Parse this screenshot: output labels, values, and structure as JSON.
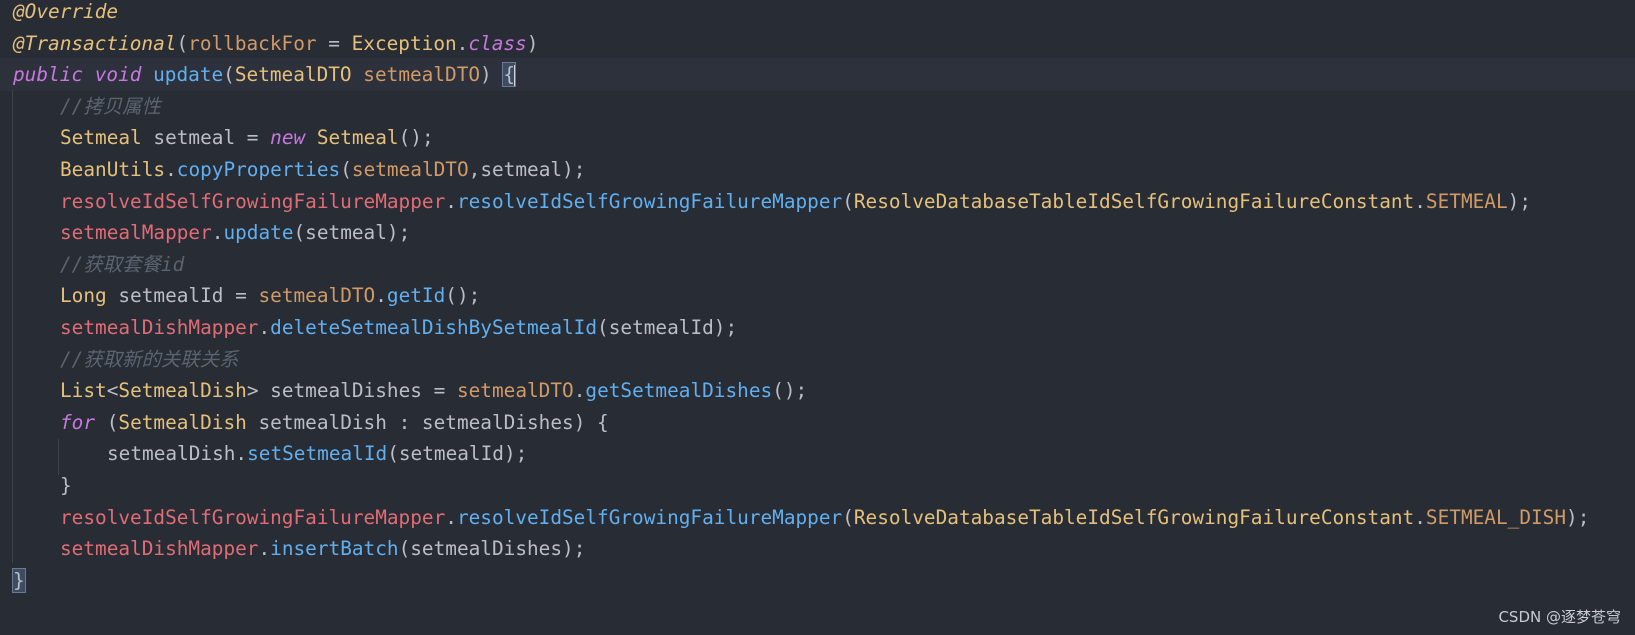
{
  "colors": {
    "background": "#282c34",
    "current_line": "#2c313c",
    "default": "#bbbec4",
    "annotation": "#e5c07b",
    "keyword": "#c678dd",
    "function": "#61afef",
    "type": "#e5c07b",
    "field": "#e06c75",
    "param": "#d19a66",
    "comment": "#5c6370",
    "constant": "#d19a66"
  },
  "code_lines": [
    {
      "indent": 0,
      "tokens": [
        {
          "t": "@Override",
          "c": "annotation",
          "i": true
        }
      ]
    },
    {
      "indent": 0,
      "tokens": [
        {
          "t": "@Transactional",
          "c": "annotation",
          "i": true
        },
        {
          "t": "(",
          "c": "default"
        },
        {
          "t": "rollbackFor",
          "c": "param"
        },
        {
          "t": " = ",
          "c": "default"
        },
        {
          "t": "Exception",
          "c": "type"
        },
        {
          "t": ".",
          "c": "default"
        },
        {
          "t": "class",
          "c": "keyword",
          "i": true
        },
        {
          "t": ")",
          "c": "default"
        }
      ]
    },
    {
      "indent": 0,
      "current": true,
      "tokens": [
        {
          "t": "public",
          "c": "keyword",
          "i": true
        },
        {
          "t": " ",
          "c": "default"
        },
        {
          "t": "void",
          "c": "keyword",
          "i": true
        },
        {
          "t": " ",
          "c": "default"
        },
        {
          "t": "update",
          "c": "function"
        },
        {
          "t": "(",
          "c": "default"
        },
        {
          "t": "SetmealDTO",
          "c": "type"
        },
        {
          "t": " ",
          "c": "default"
        },
        {
          "t": "setmealDTO",
          "c": "param"
        },
        {
          "t": ") ",
          "c": "default"
        },
        {
          "t": "{",
          "c": "default",
          "hl": true,
          "caret": true
        }
      ]
    },
    {
      "indent": 1,
      "tokens": [
        {
          "t": "//拷贝属性",
          "c": "comment",
          "i": true
        }
      ]
    },
    {
      "indent": 1,
      "tokens": [
        {
          "t": "Setmeal",
          "c": "type"
        },
        {
          "t": " setmeal = ",
          "c": "default"
        },
        {
          "t": "new",
          "c": "keyword",
          "i": true
        },
        {
          "t": " ",
          "c": "default"
        },
        {
          "t": "Setmeal",
          "c": "type"
        },
        {
          "t": "();",
          "c": "default"
        }
      ]
    },
    {
      "indent": 1,
      "tokens": [
        {
          "t": "BeanUtils",
          "c": "type"
        },
        {
          "t": ".",
          "c": "default"
        },
        {
          "t": "copyProperties",
          "c": "function"
        },
        {
          "t": "(",
          "c": "default"
        },
        {
          "t": "setmealDTO",
          "c": "param"
        },
        {
          "t": ",setmeal);",
          "c": "default"
        }
      ]
    },
    {
      "indent": 1,
      "tokens": [
        {
          "t": "resolveIdSelfGrowingFailureMapper",
          "c": "field"
        },
        {
          "t": ".",
          "c": "default"
        },
        {
          "t": "resolveIdSelfGrowingFailureMapper",
          "c": "function"
        },
        {
          "t": "(",
          "c": "default"
        },
        {
          "t": "ResolveDatabaseTableIdSelfGrowingFailureConstant",
          "c": "type"
        },
        {
          "t": ".",
          "c": "default"
        },
        {
          "t": "SETMEAL",
          "c": "constant"
        },
        {
          "t": ");",
          "c": "default"
        }
      ]
    },
    {
      "indent": 1,
      "tokens": [
        {
          "t": "setmealMapper",
          "c": "field"
        },
        {
          "t": ".",
          "c": "default"
        },
        {
          "t": "update",
          "c": "function"
        },
        {
          "t": "(setmeal);",
          "c": "default"
        }
      ]
    },
    {
      "indent": 1,
      "tokens": [
        {
          "t": "//获取套餐id",
          "c": "comment",
          "i": true
        }
      ]
    },
    {
      "indent": 1,
      "tokens": [
        {
          "t": "Long",
          "c": "type"
        },
        {
          "t": " setmealId = ",
          "c": "default"
        },
        {
          "t": "setmealDTO",
          "c": "param"
        },
        {
          "t": ".",
          "c": "default"
        },
        {
          "t": "getId",
          "c": "function"
        },
        {
          "t": "();",
          "c": "default"
        }
      ]
    },
    {
      "indent": 1,
      "tokens": [
        {
          "t": "setmealDishMapper",
          "c": "field"
        },
        {
          "t": ".",
          "c": "default"
        },
        {
          "t": "deleteSetmealDishBySetmealId",
          "c": "function"
        },
        {
          "t": "(setmealId);",
          "c": "default"
        }
      ]
    },
    {
      "indent": 1,
      "tokens": [
        {
          "t": "//获取新的关联关系",
          "c": "comment",
          "i": true
        }
      ]
    },
    {
      "indent": 1,
      "tokens": [
        {
          "t": "List",
          "c": "type"
        },
        {
          "t": "<",
          "c": "default"
        },
        {
          "t": "SetmealDish",
          "c": "type"
        },
        {
          "t": "> setmealDishes = ",
          "c": "default"
        },
        {
          "t": "setmealDTO",
          "c": "param"
        },
        {
          "t": ".",
          "c": "default"
        },
        {
          "t": "getSetmealDishes",
          "c": "function"
        },
        {
          "t": "();",
          "c": "default"
        }
      ]
    },
    {
      "indent": 1,
      "tokens": [
        {
          "t": "for",
          "c": "keyword",
          "i": true
        },
        {
          "t": " (",
          "c": "default"
        },
        {
          "t": "SetmealDish",
          "c": "type"
        },
        {
          "t": " setmealDish : setmealDishes) {",
          "c": "default"
        }
      ]
    },
    {
      "indent": 2,
      "tokens": [
        {
          "t": "setmealDish",
          "c": "default"
        },
        {
          "t": ".",
          "c": "default"
        },
        {
          "t": "setSetmealId",
          "c": "function"
        },
        {
          "t": "(setmealId);",
          "c": "default"
        }
      ]
    },
    {
      "indent": 1,
      "tokens": [
        {
          "t": "}",
          "c": "default"
        }
      ]
    },
    {
      "indent": 1,
      "tokens": [
        {
          "t": "resolveIdSelfGrowingFailureMapper",
          "c": "field"
        },
        {
          "t": ".",
          "c": "default"
        },
        {
          "t": "resolveIdSelfGrowingFailureMapper",
          "c": "function"
        },
        {
          "t": "(",
          "c": "default"
        },
        {
          "t": "ResolveDatabaseTableIdSelfGrowingFailureConstant",
          "c": "type"
        },
        {
          "t": ".",
          "c": "default"
        },
        {
          "t": "SETMEAL_DISH",
          "c": "constant"
        },
        {
          "t": ");",
          "c": "default"
        }
      ]
    },
    {
      "indent": 1,
      "tokens": [
        {
          "t": "setmealDishMapper",
          "c": "field"
        },
        {
          "t": ".",
          "c": "default"
        },
        {
          "t": "insertBatch",
          "c": "function"
        },
        {
          "t": "(setmealDishes);",
          "c": "default"
        }
      ]
    },
    {
      "indent": 0,
      "tokens": [
        {
          "t": "}",
          "c": "default",
          "hl": true
        }
      ]
    }
  ],
  "watermark": "CSDN @逐梦苍穹"
}
